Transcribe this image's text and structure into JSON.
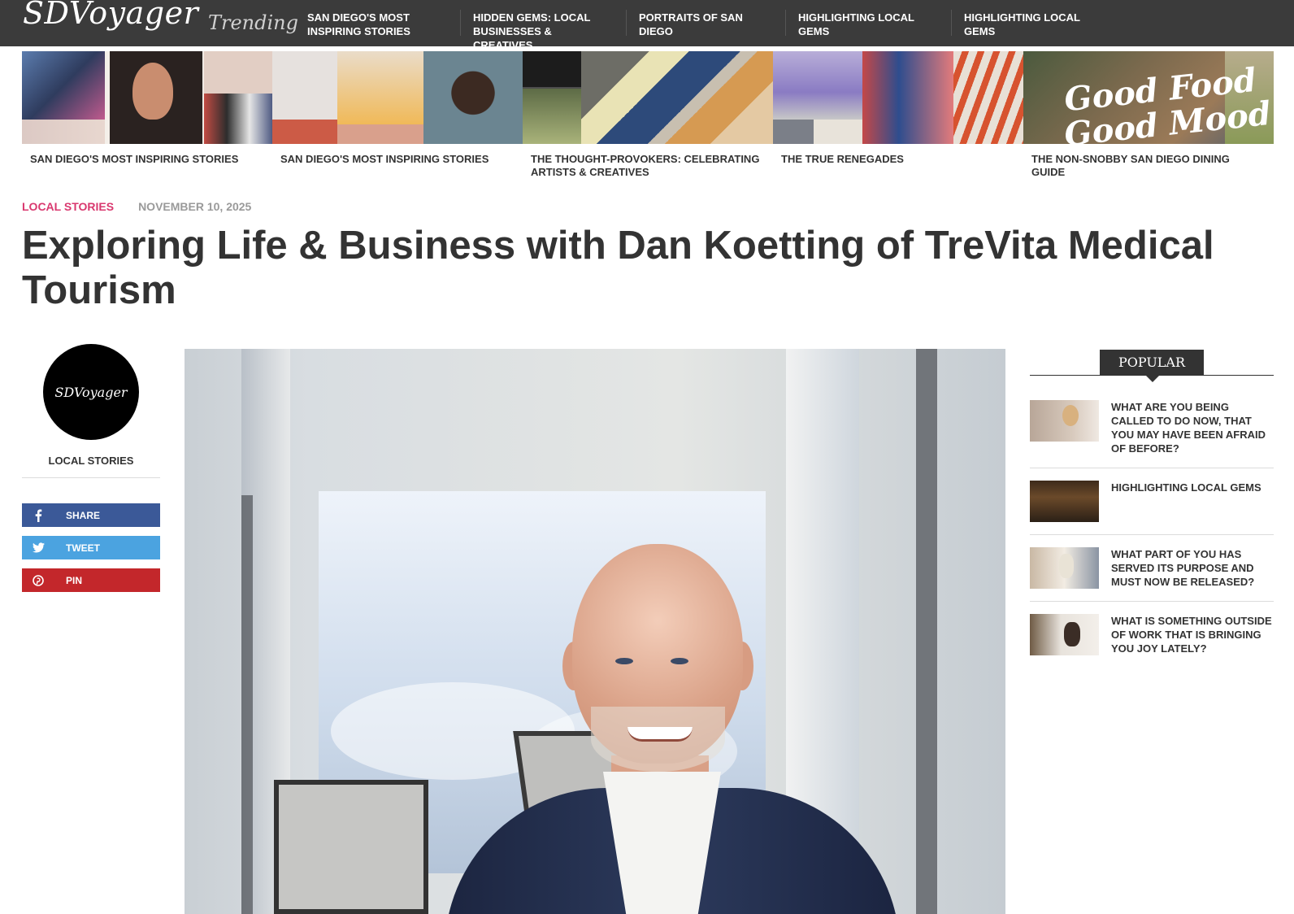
{
  "header": {
    "logo": "SDVoyager",
    "trending_label": "Trending",
    "nav": [
      {
        "label": "SAN DIEGO'S MOST INSPIRING STORIES"
      },
      {
        "label": "HIDDEN GEMS: LOCAL BUSINESSES & CREATIVES"
      },
      {
        "label": "PORTRAITS OF SAN DIEGO"
      },
      {
        "label": "HIGHLIGHTING LOCAL GEMS"
      },
      {
        "label": "HIGHLIGHTING LOCAL GEMS"
      }
    ]
  },
  "strip": [
    {
      "title": "SAN DIEGO'S MOST INSPIRING STORIES"
    },
    {
      "title": "SAN DIEGO'S MOST INSPIRING STORIES"
    },
    {
      "title": "THE THOUGHT-PROVOKERS: CELEBRATING ARTISTS & CREATIVES"
    },
    {
      "title": "THE TRUE RENEGADES"
    },
    {
      "title": "THE NON-SNOBBY SAN DIEGO DINING GUIDE",
      "image_text": [
        "Good Food",
        "Good Mood"
      ]
    }
  ],
  "article": {
    "category": "LOCAL STORIES",
    "date": "NOVEMBER 10, 2025",
    "title": "Exploring Life & Business with Dan Koetting of TreVita Medical Tourism"
  },
  "rail": {
    "badge_text": "SDVoyager",
    "category": "LOCAL STORIES",
    "share": [
      {
        "label": "SHARE",
        "icon": "facebook-icon"
      },
      {
        "label": "TWEET",
        "icon": "twitter-icon"
      },
      {
        "label": "PIN",
        "icon": "pinterest-icon"
      }
    ]
  },
  "popular": {
    "heading": "POPULAR",
    "items": [
      {
        "title": "WHAT ARE YOU BEING CALLED TO DO NOW, THAT YOU MAY HAVE BEEN AFRAID OF BEFORE?"
      },
      {
        "title": "HIGHLIGHTING LOCAL GEMS"
      },
      {
        "title": "WHAT PART OF YOU HAS SERVED ITS PURPOSE AND MUST NOW BE RELEASED?"
      },
      {
        "title": "WHAT IS SOMETHING OUTSIDE OF WORK THAT IS BRINGING YOU JOY LATELY?"
      }
    ]
  },
  "colors": {
    "topbar": "#3b3b3b",
    "category_accent": "#d9386f",
    "facebook": "#3b5998",
    "twitter": "#4ba3e0",
    "pinterest": "#c3272b"
  }
}
